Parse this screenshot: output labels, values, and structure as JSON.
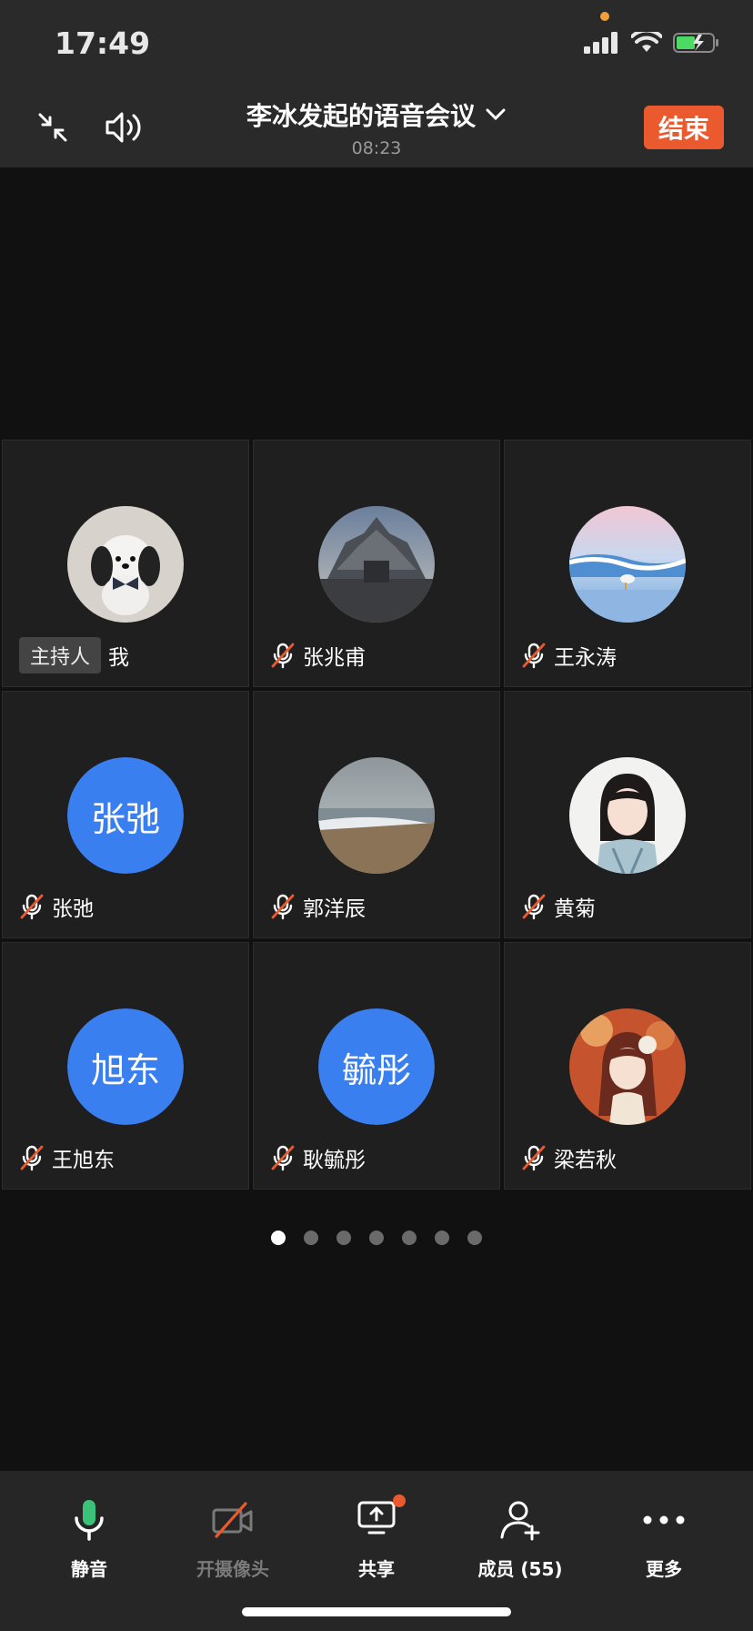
{
  "status_bar": {
    "time": "17:49"
  },
  "header": {
    "title": "李冰发起的语音会议",
    "timer": "08:23",
    "end_label": "结束"
  },
  "participants": [
    {
      "name": "我",
      "host_tag": "主持人",
      "avatar": "photo-plush-dog"
    },
    {
      "name": "张兆甫",
      "muted": true,
      "avatar": "photo-temple"
    },
    {
      "name": "王永涛",
      "muted": true,
      "avatar": "photo-seagull-beach"
    },
    {
      "name": "张弛",
      "muted": true,
      "avatar_text": "张弛"
    },
    {
      "name": "郭洋辰",
      "muted": true,
      "avatar": "photo-beach"
    },
    {
      "name": "黄菊",
      "muted": true,
      "avatar": "photo-girl"
    },
    {
      "name": "王旭东",
      "muted": true,
      "avatar_text": "旭东"
    },
    {
      "name": "耿毓彤",
      "muted": true,
      "avatar_text": "毓彤"
    },
    {
      "name": "梁若秋",
      "muted": true,
      "avatar": "photo-anime-girl"
    }
  ],
  "pagination": {
    "pages": 7,
    "current": 1
  },
  "toolbar": {
    "mute": "静音",
    "camera": "开摄像头",
    "share": "共享",
    "members": "成员 (55)",
    "more": "更多"
  },
  "colors": {
    "accent": "#ea5a2e",
    "avatar_blue": "#3a7ff0",
    "mic_green": "#3ac27a"
  }
}
